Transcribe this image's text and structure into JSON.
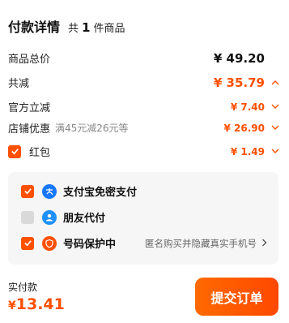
{
  "header": {
    "title": "付款详情",
    "count_prefix": "共",
    "count": "1",
    "count_suffix": "件商品"
  },
  "summary": {
    "total_label": "商品总价",
    "total_amount": "¥ 49.20",
    "discount_label": "共减",
    "discount_amount": "¥ 35.79",
    "official_label": "官方立减",
    "official_amount": "¥ 7.40",
    "shop_label": "店铺优惠",
    "shop_sublabel": "满45元减26元等",
    "shop_amount": "¥ 26.90",
    "redpacket_label": "红包",
    "redpacket_amount": "¥ 1.49",
    "redpacket_checked": true
  },
  "options": [
    {
      "label": "支付宝免密支付",
      "icon": "alipay-icon",
      "checked": true,
      "color": "#1677ff"
    },
    {
      "label": "朋友代付",
      "icon": "friend-pay-icon",
      "checked": false,
      "color": "#1e90ff"
    },
    {
      "label": "号码保护中",
      "icon": "shield-icon",
      "checked": true,
      "color": "#ff5000",
      "description": "匿名购买并隐藏真实手机号"
    }
  ],
  "footer": {
    "paid_label": "实付款",
    "paid_currency": "¥",
    "paid_amount": "13.41",
    "submit_label": "提交订单"
  },
  "colors": {
    "accent": "#ff5000",
    "panel": "#f6f6f6"
  }
}
